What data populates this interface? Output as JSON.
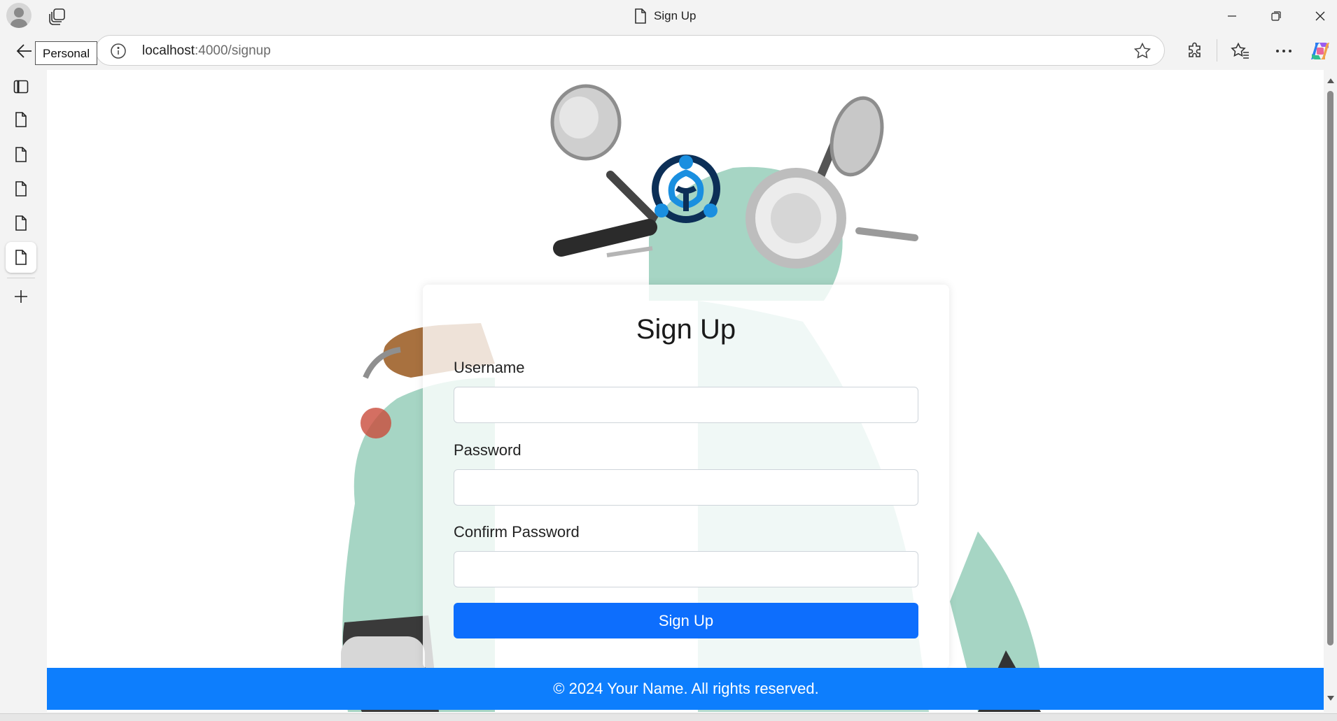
{
  "browser": {
    "window_title": "Sign Up",
    "profile_tooltip": "Personal",
    "url_host": "localhost",
    "url_path": ":4000/signup",
    "vertical_tabs": [
      "sidebar-toggle",
      "page",
      "page",
      "page",
      "page",
      "page (active)"
    ]
  },
  "page": {
    "heading": "Sign Up",
    "fields": [
      {
        "label": "Username",
        "value": ""
      },
      {
        "label": "Password",
        "value": ""
      },
      {
        "label": "Confirm Password",
        "value": ""
      }
    ],
    "submit_label": "Sign Up",
    "footer": "© 2024 Your Name. All rights reserved."
  },
  "colors": {
    "primary_button": "#0d6efd",
    "footer_bg": "#0d7efd",
    "logo_dark": "#0c2f57",
    "logo_light": "#1a8fe0",
    "scooter_body": "#a6d5c4",
    "seat": "#a8713f"
  },
  "icons": [
    "profile-icon",
    "tab-actions-icon",
    "page-icon",
    "minimize-icon",
    "restore-icon",
    "close-icon",
    "back-icon",
    "info-icon",
    "favorite-star-icon",
    "extensions-icon",
    "favorites-icon",
    "more-icon",
    "copilot-icon",
    "sidebar-icon",
    "new-tab-icon",
    "logo-icon"
  ]
}
